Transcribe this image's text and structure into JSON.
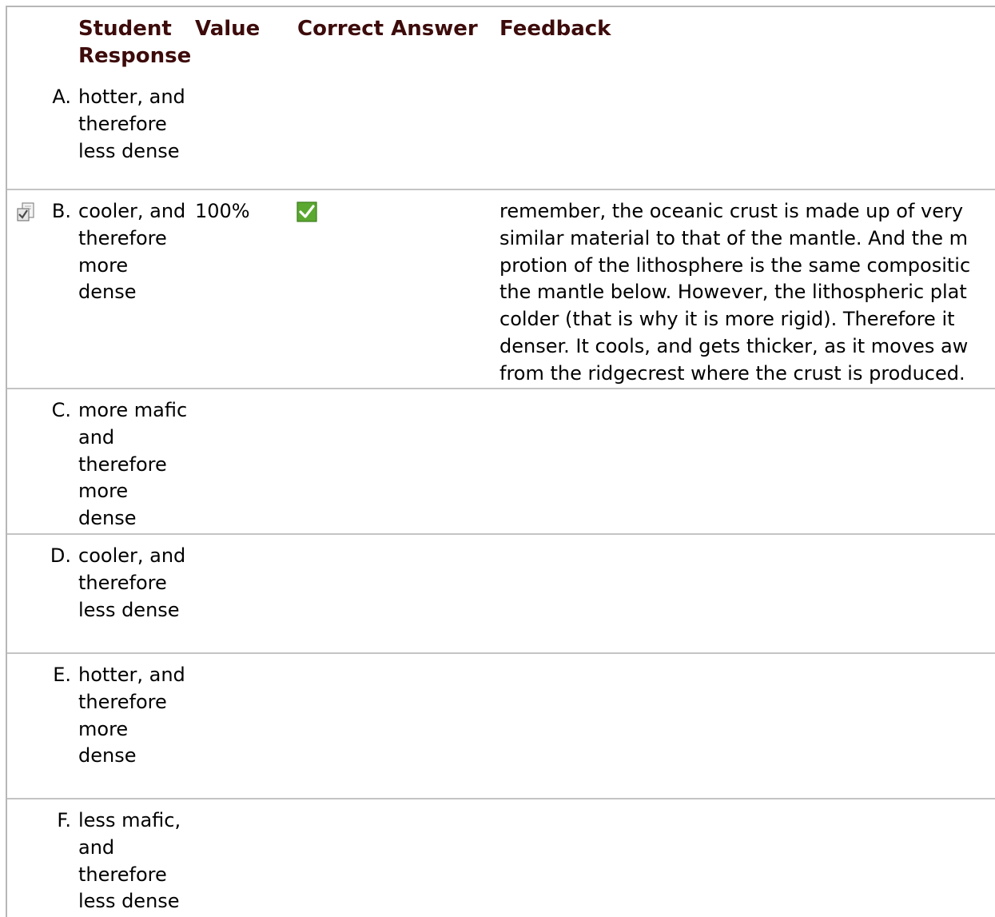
{
  "headers": {
    "student_response": "Student Response",
    "value": "Value",
    "correct_answer": "Correct Answer",
    "feedback": "Feedback"
  },
  "rows": [
    {
      "letter": "A.",
      "response": "hotter, and therefore less dense",
      "value": "",
      "correct": false,
      "selected": false,
      "feedback": []
    },
    {
      "letter": "B.",
      "response": "cooler, and therefore more dense",
      "value": "100%",
      "correct": true,
      "selected": true,
      "feedback": [
        "remember, the oceanic crust is made up of very",
        "similar material to that of the mantle. And the m",
        "protion of the lithosphere is the same compositic",
        "the mantle below. However, the lithospheric plat",
        "colder (that is why it is more rigid). Therefore it",
        "denser. It cools, and gets thicker, as it moves aw",
        "from the ridgecrest where the crust is produced."
      ]
    },
    {
      "letter": "C.",
      "response": "more mafic and therefore more dense",
      "value": "",
      "correct": false,
      "selected": false,
      "feedback": []
    },
    {
      "letter": "D.",
      "response": "cooler, and therefore less dense",
      "value": "",
      "correct": false,
      "selected": false,
      "feedback": []
    },
    {
      "letter": "E.",
      "response": "hotter, and therefore more dense",
      "value": "",
      "correct": false,
      "selected": false,
      "feedback": []
    },
    {
      "letter": "F.",
      "response": "less mafic, and therefore less dense",
      "value": "",
      "correct": false,
      "selected": false,
      "feedback": []
    }
  ],
  "icons": {
    "selected_answer": "selected-answer-icon",
    "correct_answer": "checkmark-icon"
  },
  "colors": {
    "header_text": "#3d0b0b",
    "check_green": "#5aa830",
    "row_divider": "#c4c4c4"
  }
}
